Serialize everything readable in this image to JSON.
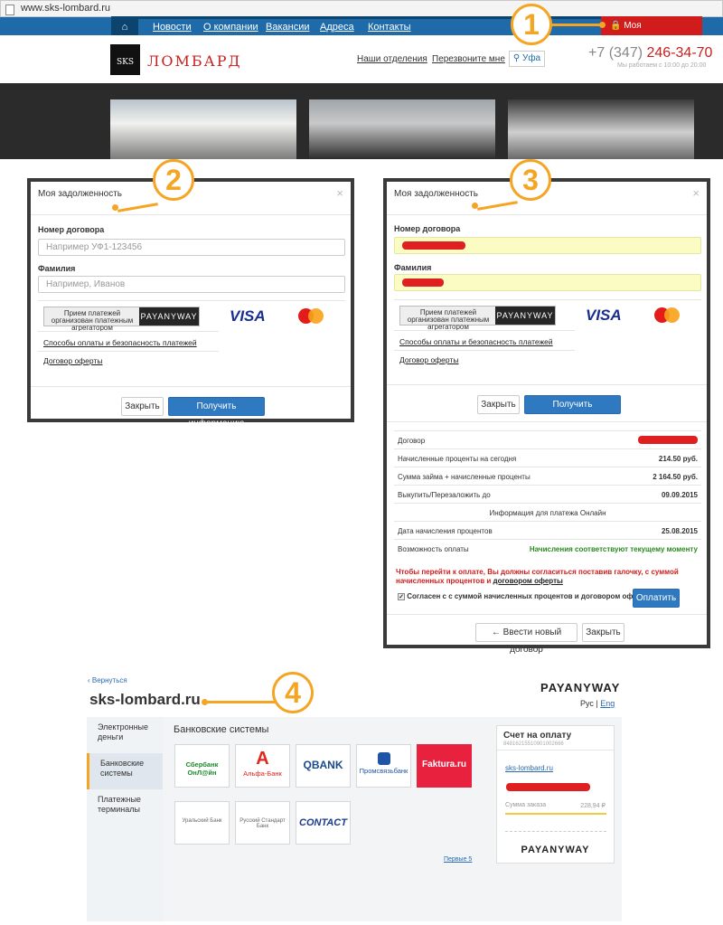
{
  "browser": {
    "url": "www.sks-lombard.ru"
  },
  "topnav": {
    "items": [
      "Новости",
      "О компании",
      "Вакансии",
      "Адреса",
      "Контакты"
    ],
    "debt_label": "Моя задолженность"
  },
  "header": {
    "logo_letters": "SKS",
    "logo_text": "ЛОМБАРД",
    "links": [
      "Наши отделения",
      "Перезвоните мне"
    ],
    "city": "Уфа",
    "phone_prefix": "+7 (347)",
    "phone_number": "246-34-70",
    "hours": "Мы работаем с 10:00 до 20:00"
  },
  "callouts": [
    "1",
    "2",
    "3",
    "4"
  ],
  "modal": {
    "title": "Моя задолженность",
    "contract_label": "Номер договора",
    "contract_placeholder": "Например УФ1-123456",
    "surname_label": "Фамилия",
    "surname_placeholder": "Например, Иванов",
    "aggregator_text": "Прием платежей организован платежным агрегатором",
    "payanyway": "PAYANYWAY",
    "visa": "VISA",
    "payment_methods_link": "Способы оплаты и безопасность платежей",
    "offer_link": "Договор оферты",
    "close_button": "Закрыть",
    "get_info_button": "Получить информацию"
  },
  "result": {
    "rows": [
      {
        "key": "Договор",
        "value": ""
      },
      {
        "key": "Начисленные проценты на сегодня",
        "value": "214.50 руб."
      },
      {
        "key": "Сумма займа + начисленные проценты",
        "value": "2 164.50 руб."
      },
      {
        "key": "Выкупить/Перезаложить до",
        "value": "09.09.2015"
      }
    ],
    "online_header": "Информация для платежа Онлайн",
    "rows2": [
      {
        "key": "Дата начисления процентов",
        "value": "25.08.2015"
      },
      {
        "key": "Возможность оплаты",
        "value": "Начисления соответствуют текущему моменту"
      }
    ],
    "warning": "Чтобы перейти к оплате, Вы должны согласиться поставив галочку, с суммой начисленных процентов и",
    "warning_link": "договором оферты",
    "agree_text": "Согласен с с суммой начисленных процентов и договором оферты",
    "pay_button": "Оплатить",
    "new_contract_button": "← Ввести новый договор",
    "close_button": "Закрыть"
  },
  "payanyway_page": {
    "back_link": "‹ Вернуться",
    "site": "sks-lombard.ru",
    "brand": "PAYANYWAY",
    "lang_ru": "Рус",
    "lang_en": "Eng",
    "sidebar": [
      "Электронные деньги",
      "Банковские системы",
      "Платежные терминалы"
    ],
    "section_title": "Банковские системы",
    "banks": [
      "Сбербанк ОнЛ@йн",
      "Альфа-Банк",
      "QBANK",
      "Промсвязьбанк",
      "Faktura.ru",
      "Уральский Банк",
      "Русский Стандарт Банк",
      "CONTACT"
    ],
    "first5_link": "Первые 5",
    "invoice_title": "Счет на оплату",
    "invoice_number": "84816215510901002666",
    "invoice_site": "sks-lombard.ru",
    "invoice_sum_label": "Сумма заказа",
    "invoice_sum_value": "228,94 ₽"
  },
  "colors": {
    "accent": "#f5a524",
    "nav_blue": "#1f6aa8",
    "brand_red": "#d11c1c"
  }
}
